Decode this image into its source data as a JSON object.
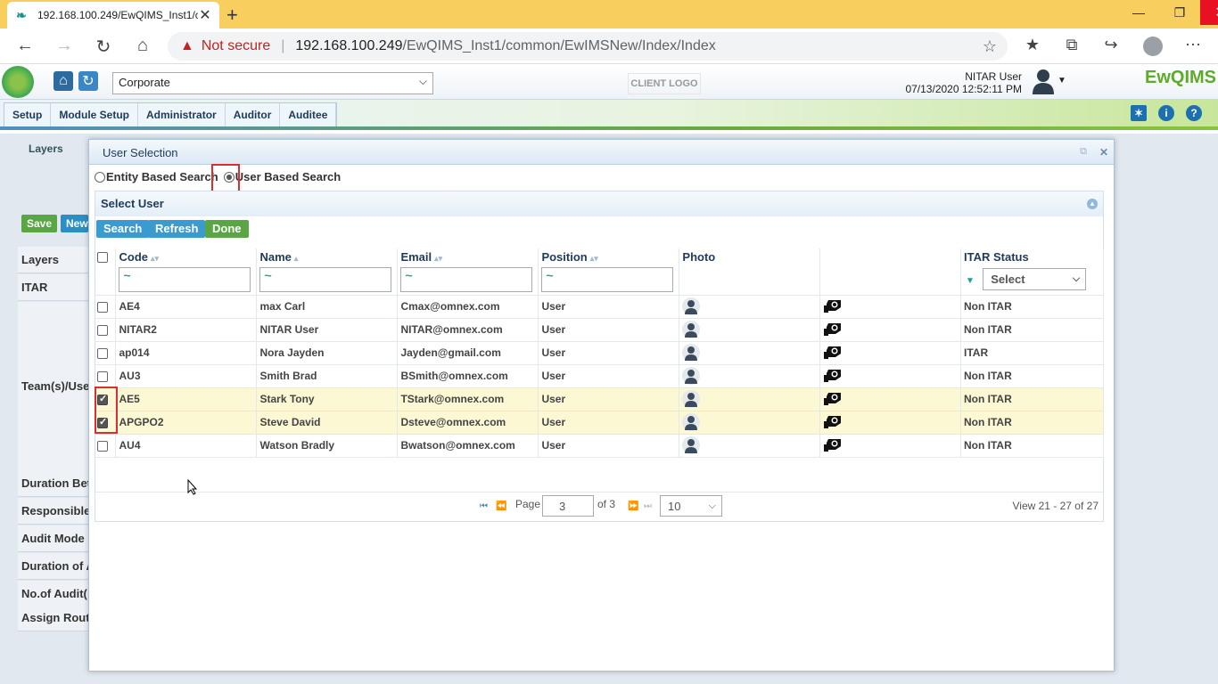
{
  "browser": {
    "tab_title": "192.168.100.249/EwQIMS_Inst1/c",
    "security_label": "Not secure",
    "url_host": "192.168.100.249",
    "url_path": "/EwQIMS_Inst1/common/EwIMSNew/Index/Index"
  },
  "header": {
    "site_select": "Corporate",
    "client_logo": "CLIENT LOGO",
    "user_name": "NITAR User",
    "datetime": "07/13/2020 12:52:11 PM",
    "brand": "EwQIMS"
  },
  "menu": [
    "Setup",
    "Module Setup",
    "Administrator",
    "Auditor",
    "Auditee"
  ],
  "background": {
    "breadcrumb": "Layers",
    "save_btn": "Save",
    "new_btn": "New",
    "labels": [
      "Layers",
      "ITAR",
      "Team(s)/Use",
      "Duration Bet",
      "Responsible",
      "Audit Mode",
      "Duration of A",
      "No.of Audit(",
      "Assign Route"
    ]
  },
  "modal": {
    "title": "User Selection",
    "radio_entity": "Entity Based Search",
    "radio_user": "User Based Search",
    "panel_title": "Select User",
    "btn_search": "Search",
    "btn_refresh": "Refresh",
    "btn_done": "Done"
  },
  "grid": {
    "columns": [
      "Code",
      "Name",
      "Email",
      "Position",
      "Photo",
      "",
      "ITAR Status"
    ],
    "filter_placeholder": "~",
    "itar_filter": "Select",
    "rows": [
      {
        "code": "AE4",
        "name": "max Carl",
        "email": "Cmax@omnex.com",
        "position": "User",
        "itar": "Non ITAR",
        "checked": false
      },
      {
        "code": "NITAR2",
        "name": "NITAR User",
        "email": "NITAR@omnex.com",
        "position": "User",
        "itar": "Non ITAR",
        "checked": false
      },
      {
        "code": "ap014",
        "name": "Nora Jayden",
        "email": "Jayden@gmail.com",
        "position": "User",
        "itar": "ITAR",
        "checked": false
      },
      {
        "code": "AU3",
        "name": "Smith Brad",
        "email": "BSmith@omnex.com",
        "position": "User",
        "itar": "Non ITAR",
        "checked": false
      },
      {
        "code": "AE5",
        "name": "Stark Tony",
        "email": "TStark@omnex.com",
        "position": "User",
        "itar": "Non ITAR",
        "checked": true
      },
      {
        "code": "APGPO2",
        "name": "Steve David",
        "email": "Dsteve@omnex.com",
        "position": "User",
        "itar": "Non ITAR",
        "checked": true
      },
      {
        "code": "AU4",
        "name": "Watson Bradly",
        "email": "Bwatson@omnex.com",
        "position": "User",
        "itar": "Non ITAR",
        "checked": false
      }
    ]
  },
  "pager": {
    "page_label": "Page",
    "page_value": "3",
    "of_label": "of 3",
    "rows_per_page": "10",
    "view_text": "View 21 - 27 of 27"
  }
}
